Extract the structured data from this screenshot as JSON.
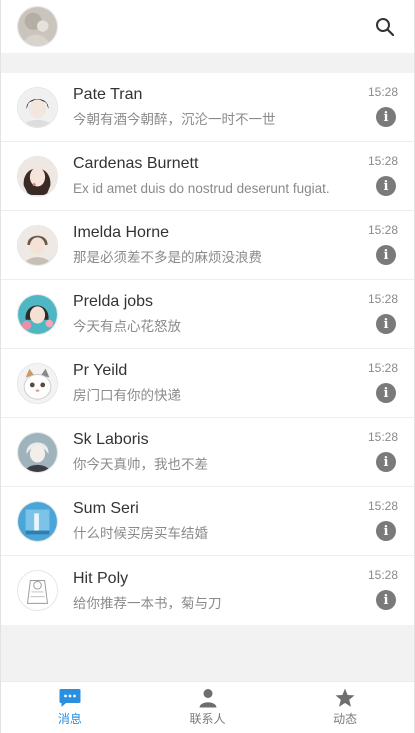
{
  "header": {
    "avatar_icon": "user-avatar",
    "search_icon": "search-icon"
  },
  "conversations": [
    {
      "name": "Pate Tran",
      "message": "今朝有酒今朝醉，沉沦一时不一世",
      "time": "15:28"
    },
    {
      "name": "Cardenas Burnett",
      "message": "Ex id amet duis do nostrud deserunt fugiat.",
      "time": "15:28"
    },
    {
      "name": "Imelda Horne",
      "message": "那是必须差不多是的麻烦没浪费",
      "time": "15:28"
    },
    {
      "name": "Prelda jobs",
      "message": "今天有点心花怒放",
      "time": "15:28"
    },
    {
      "name": "Pr Yeild",
      "message": "房门口有你的快递",
      "time": "15:28"
    },
    {
      "name": "Sk Laboris",
      "message": "你今天真帅，我也不差",
      "time": "15:28"
    },
    {
      "name": "Sum Seri",
      "message": "什么时候买房买车结婚",
      "time": "15:28"
    },
    {
      "name": "Hit Poly",
      "message": "给你推荐一本书，菊与刀",
      "time": "15:28"
    }
  ],
  "info_icon": "info-icon",
  "tabbar": {
    "tabs": [
      {
        "label": "消息",
        "icon": "message-icon",
        "active": true
      },
      {
        "label": "联系人",
        "icon": "person-icon",
        "active": false
      },
      {
        "label": "动态",
        "icon": "star-icon",
        "active": false
      }
    ]
  },
  "colors": {
    "accent": "#2b8fe0",
    "inactive": "#7a7a7a",
    "background": "#f2f2f2"
  }
}
